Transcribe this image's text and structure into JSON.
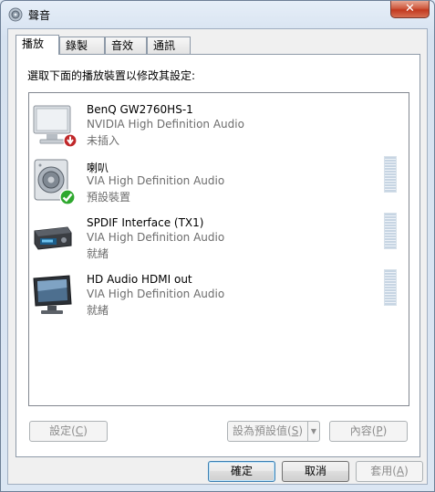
{
  "window": {
    "title": "聲音",
    "close_label": "✕"
  },
  "tabs": [
    {
      "label": "播放",
      "active": true
    },
    {
      "label": "錄製",
      "active": false
    },
    {
      "label": "音效",
      "active": false
    },
    {
      "label": "通訊",
      "active": false
    }
  ],
  "instruction": "選取下面的播放裝置以修改其設定:",
  "devices": [
    {
      "name": "BenQ GW2760HS-1",
      "driver": "NVIDIA High Definition Audio",
      "status": "未插入",
      "icon": "monitor-icon",
      "badge": "unplugged-badge-icon"
    },
    {
      "name": "喇叭",
      "driver": "VIA High Definition Audio",
      "status": "預設裝置",
      "icon": "speaker-icon",
      "badge": "default-check-badge-icon"
    },
    {
      "name": "SPDIF Interface (TX1)",
      "driver": "VIA High Definition Audio",
      "status": "就緒",
      "icon": "receiver-icon",
      "badge": ""
    },
    {
      "name": "HD Audio HDMI out",
      "driver": "VIA High Definition Audio",
      "status": "就緒",
      "icon": "monitor-icon",
      "badge": ""
    }
  ],
  "buttons": {
    "configure": {
      "label": "設定(",
      "key": "C",
      "suffix": ")"
    },
    "set_default": {
      "label": "設為預設值(",
      "key": "S",
      "suffix": ")"
    },
    "properties": {
      "label": "內容(",
      "key": "P",
      "suffix": ")"
    },
    "ok": "確定",
    "cancel": "取消",
    "apply": {
      "label": "套用(",
      "key": "A",
      "suffix": ")"
    }
  },
  "colors": {
    "check_green": "#2ea82e",
    "unplugged_red": "#c0282a",
    "selection_blue": "#3c7fb1"
  }
}
